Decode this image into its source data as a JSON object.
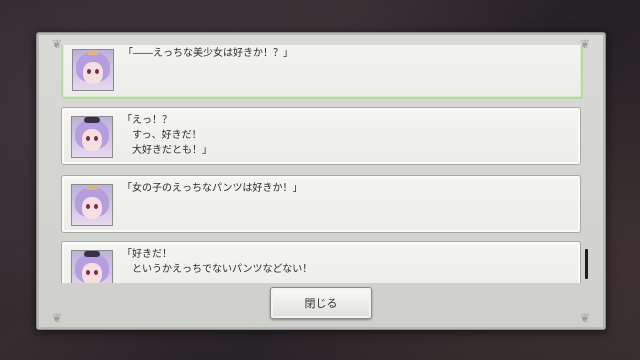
{
  "log": {
    "entries": [
      {
        "speaker_icon": "princess-avatar-icon",
        "lines": [
          "「――えっちな美少女は好きか！？」"
        ],
        "selected": true
      },
      {
        "speaker_icon": "maid-avatar-icon",
        "lines": [
          "「えっ！？",
          "　すっ、好きだ！",
          "　大好きだとも！」"
        ],
        "selected": false
      },
      {
        "speaker_icon": "princess-avatar-icon",
        "lines": [
          "「女の子のえっちなパンツは好きか！」"
        ],
        "selected": false
      },
      {
        "speaker_icon": "maid-avatar-icon",
        "lines": [
          "「好きだ！",
          "　というかえっちでないパンツなどない！"
        ],
        "selected": false
      }
    ]
  },
  "buttons": {
    "close_label": "閉じる"
  },
  "colors": {
    "selected_border": "#b9d8a6",
    "panel": "#d9d9d6"
  }
}
